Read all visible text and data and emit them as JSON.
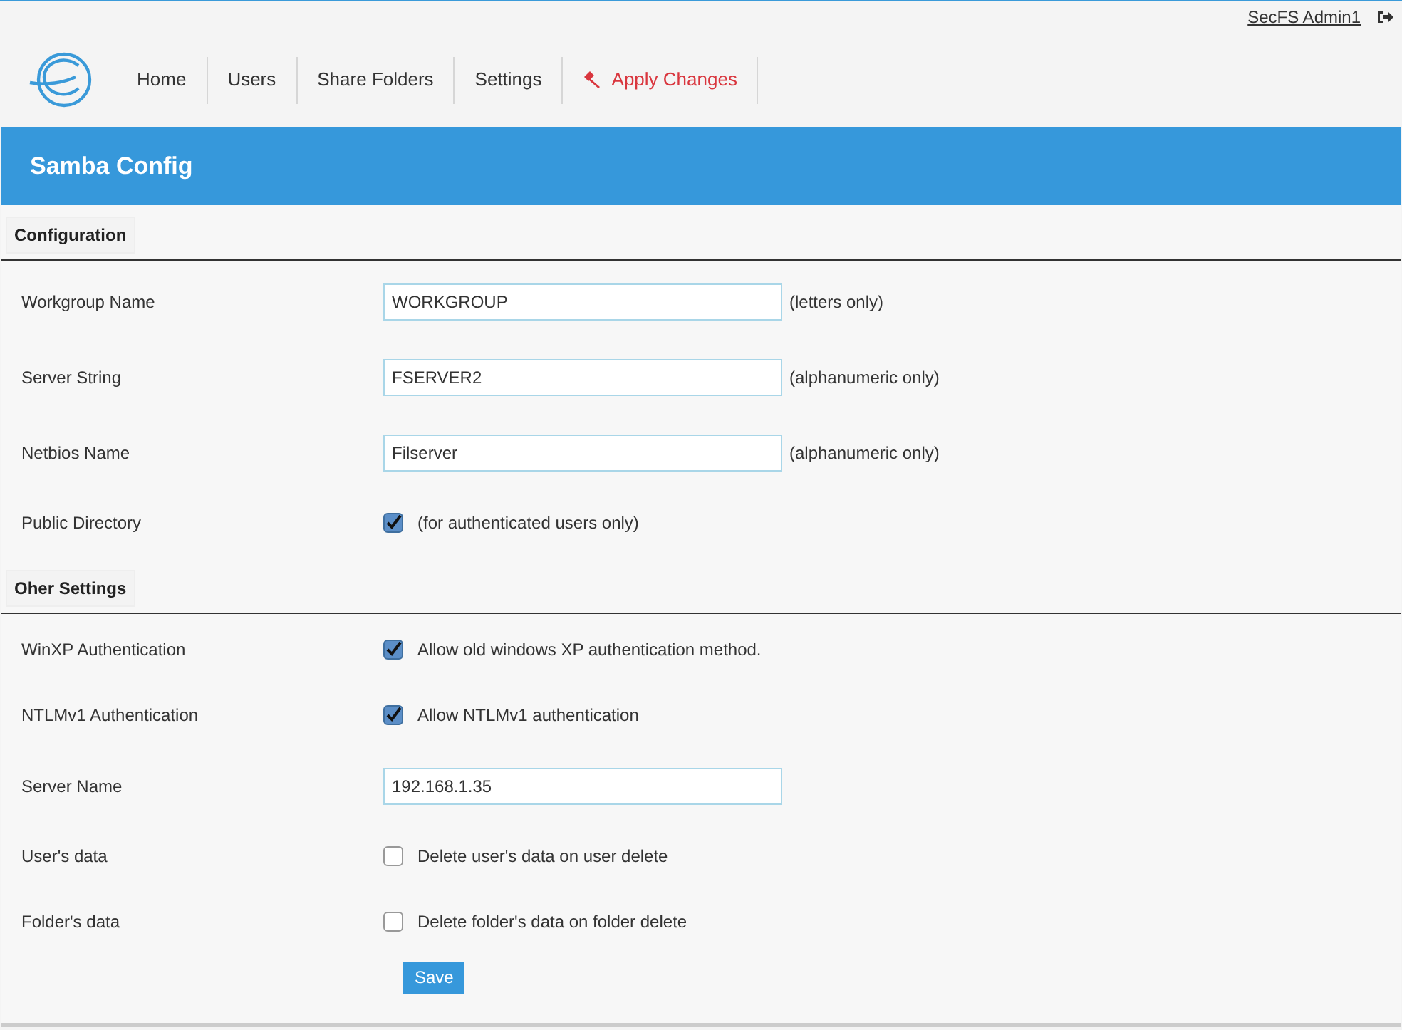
{
  "user_link": "SecFS Admin1",
  "nav": [
    {
      "label": "Home",
      "kind": "link"
    },
    {
      "label": "Users",
      "kind": "link"
    },
    {
      "label": "Share Folders",
      "kind": "link"
    },
    {
      "label": "Settings",
      "kind": "link"
    },
    {
      "label": "Apply Changes",
      "kind": "action"
    }
  ],
  "page_title": "Samba Config",
  "sections": [
    {
      "title": "Configuration",
      "rows": [
        {
          "label": "Workgroup Name",
          "kind": "text",
          "value": "WORKGROUP",
          "hint": "(letters only)"
        },
        {
          "label": "Server String",
          "kind": "text",
          "value": "FSERVER2",
          "hint": "(alphanumeric only)"
        },
        {
          "label": "Netbios Name",
          "kind": "text",
          "value": "Filserver",
          "hint": "(alphanumeric only)"
        },
        {
          "label": "Public Directory",
          "kind": "checkbox",
          "checked": true,
          "hint": "(for authenticated users only)"
        }
      ]
    },
    {
      "title": "Oher Settings",
      "rows": [
        {
          "label": "WinXP Authentication",
          "kind": "checkbox",
          "checked": true,
          "hint": "Allow old windows XP authentication method."
        },
        {
          "label": "NTLMv1 Authentication",
          "kind": "checkbox",
          "checked": true,
          "hint": "Allow NTLMv1 authentication"
        },
        {
          "label": "Server Name",
          "kind": "text",
          "value": "192.168.1.35"
        },
        {
          "label": "User's data",
          "kind": "checkbox",
          "checked": false,
          "hint": "Delete user's data on user delete"
        },
        {
          "label": "Folder's data",
          "kind": "checkbox",
          "checked": false,
          "hint": "Delete folder's data on folder delete"
        }
      ]
    }
  ],
  "save_button": "Save"
}
